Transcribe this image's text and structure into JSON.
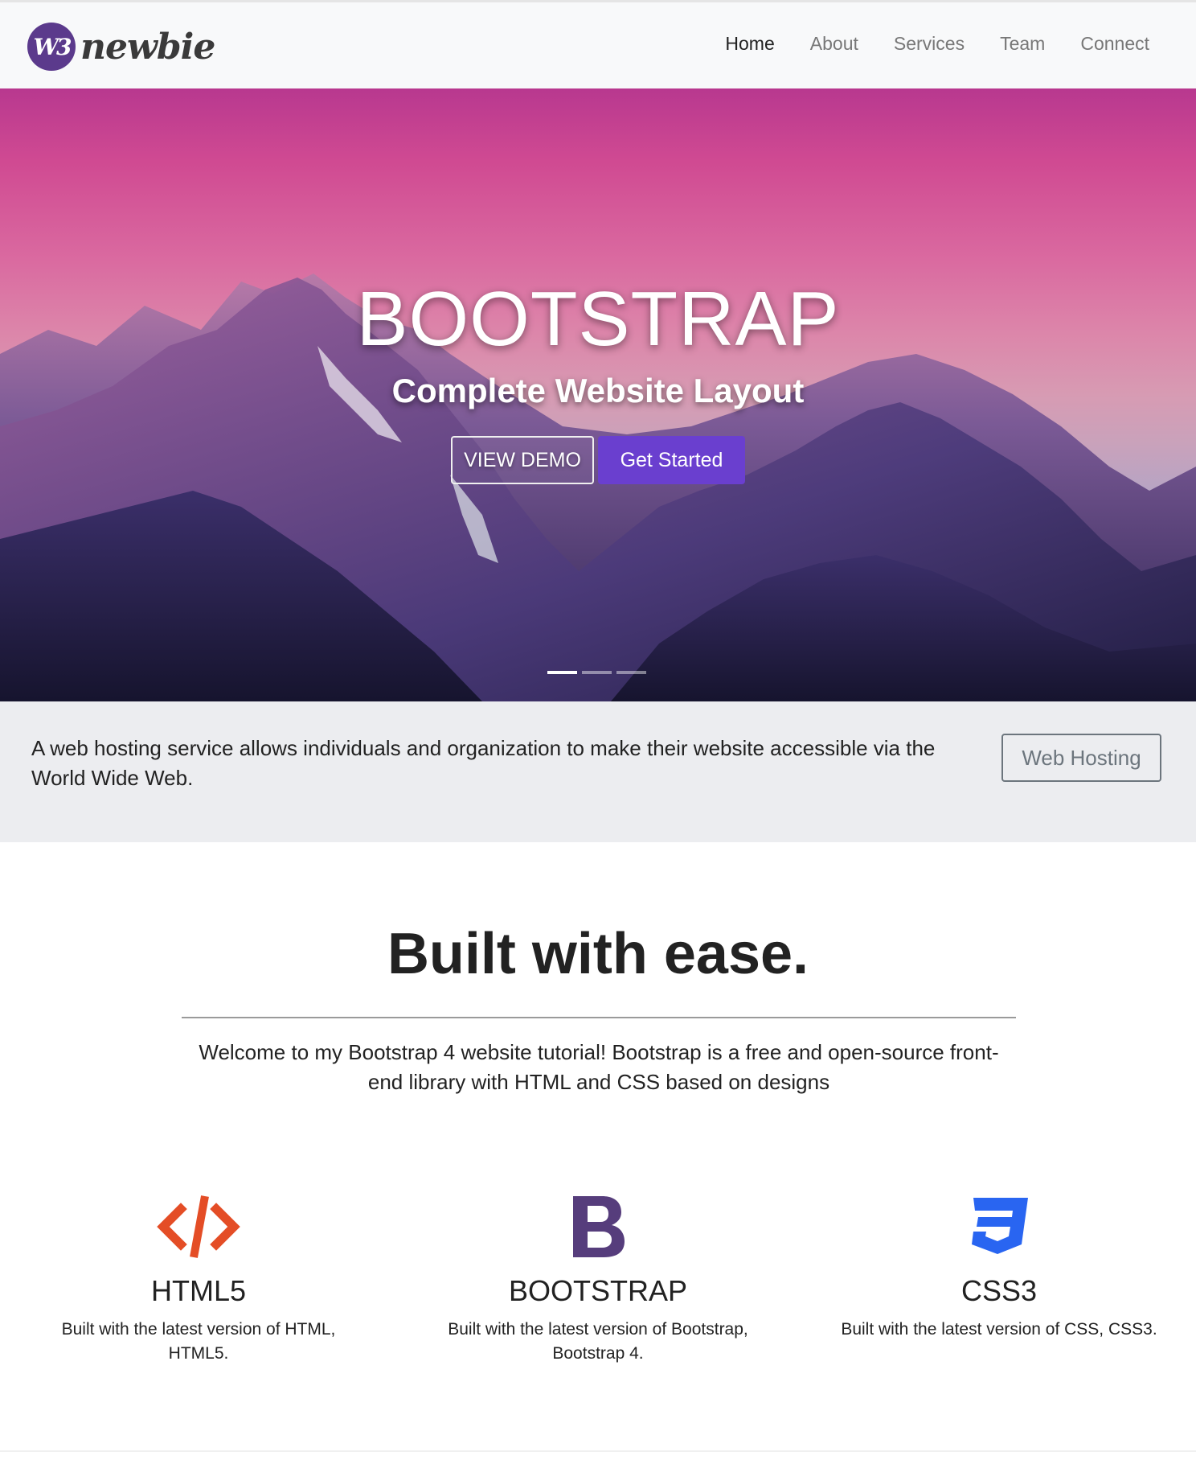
{
  "brand": {
    "logo_mark": "W3",
    "name": "newbie"
  },
  "nav": {
    "items": [
      "Home",
      "About",
      "Services",
      "Team",
      "Connect"
    ],
    "active": "Home"
  },
  "hero": {
    "title": "BOOTSTRAP",
    "subtitle": "Complete Website Layout",
    "demo_button": "VIEW DEMO",
    "start_button": "Get Started",
    "slides_total": 3,
    "active_slide": 1
  },
  "hosting": {
    "text": "A web hosting service allows individuals and organization to make their website accessible via the World Wide Web.",
    "button": "Web Hosting"
  },
  "welcome": {
    "title": "Built with ease.",
    "lead": "Welcome to my Bootstrap 4 website tutorial! Bootstrap is a free and open-source front-end library with HTML and CSS based on designs"
  },
  "features": [
    {
      "icon": "code-icon",
      "title": "HTML5",
      "text": "Built with the latest version of HTML, HTML5.",
      "color": "#e44d26"
    },
    {
      "icon": "bootstrap-icon",
      "title": "BOOTSTRAP",
      "text": "Built with the latest version of Bootstrap, Bootstrap 4.",
      "color": "#563d7c"
    },
    {
      "icon": "css3-icon",
      "title": "CSS3",
      "text": "Built with the latest version of CSS, CSS3.",
      "color": "#2965f1"
    }
  ],
  "colors": {
    "primary_button": "#6a3fcf",
    "band_background": "#ecedf0",
    "navbar_background": "#f8f9fa"
  }
}
